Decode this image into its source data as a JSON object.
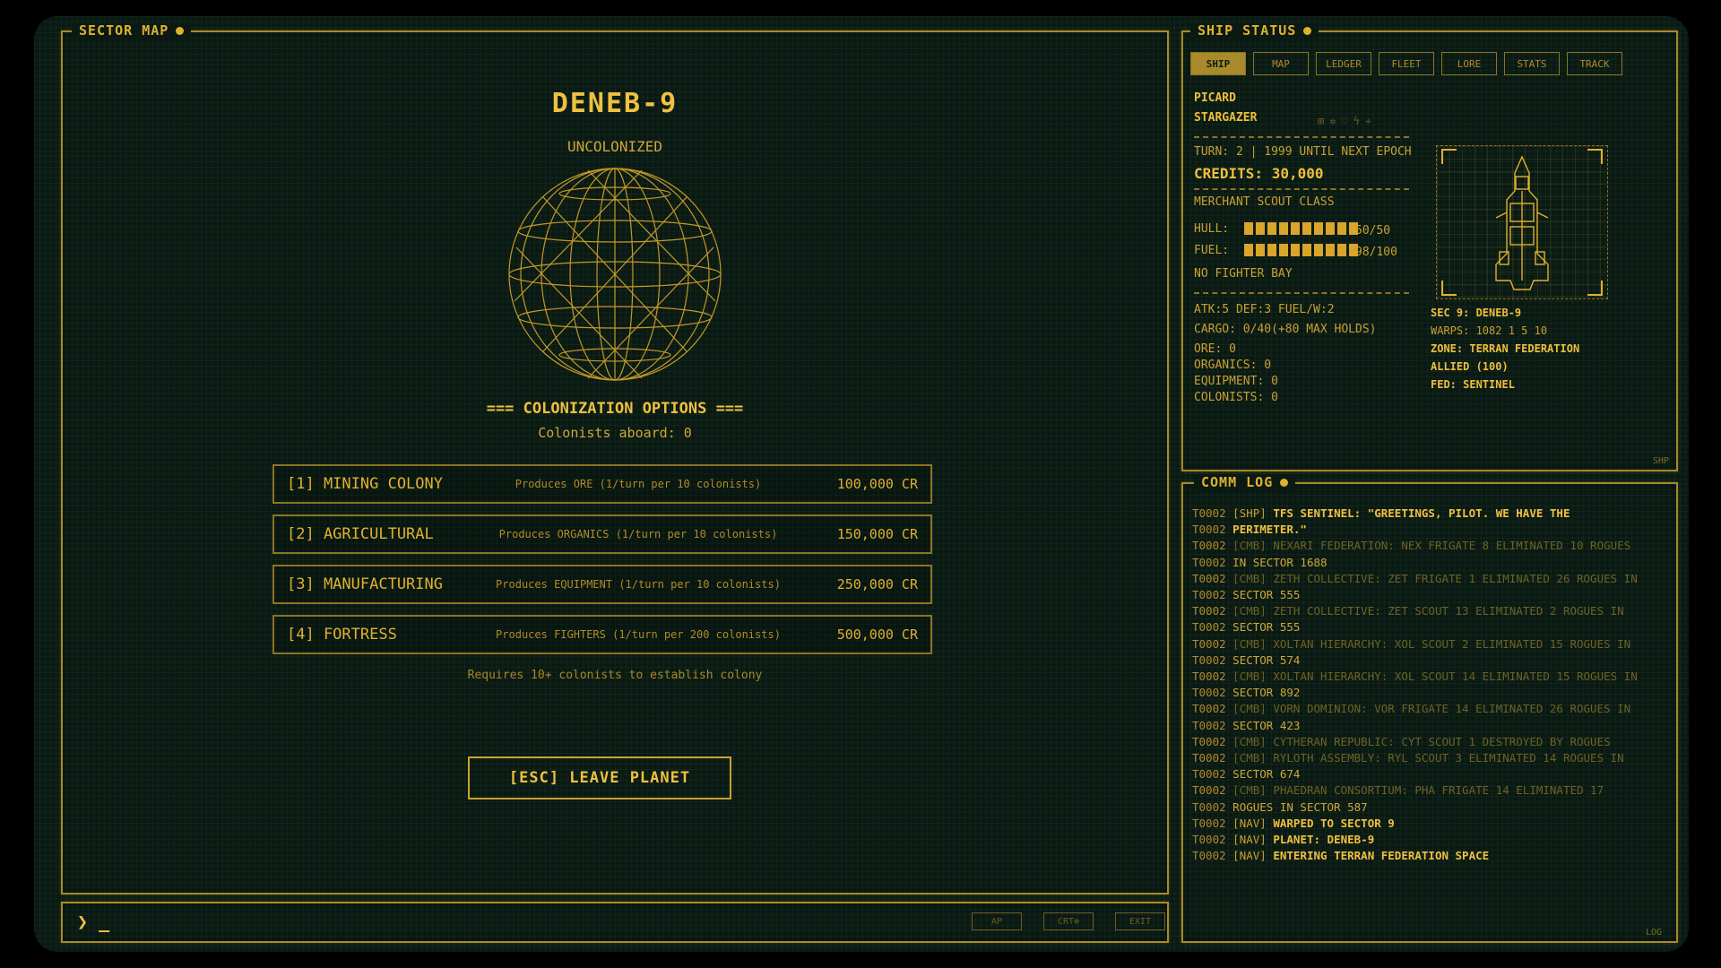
{
  "sector": {
    "title": "SECTOR MAP",
    "planet_name": "DENEB-9",
    "planet_status": "UNCOLONIZED",
    "colonization_title": "=== COLONIZATION OPTIONS ===",
    "colonists": "Colonists aboard: 0",
    "options": [
      {
        "name": "[1] MINING COLONY",
        "desc": "Produces ORE (1/turn per 10 colonists)",
        "price": "100,000 CR"
      },
      {
        "name": "[2] AGRICULTURAL",
        "desc": "Produces ORGANICS (1/turn per 10 colonists)",
        "price": "150,000 CR"
      },
      {
        "name": "[3] MANUFACTURING",
        "desc": "Produces EQUIPMENT (1/turn per 10 colonists)",
        "price": "250,000 CR"
      },
      {
        "name": "[4] FORTRESS",
        "desc": "Produces FIGHTERS (1/turn per 200 colonists)",
        "price": "500,000 CR"
      }
    ],
    "requirement": "Requires 10+ colonists to establish colony",
    "leave_button": "[ESC] LEAVE PLANET"
  },
  "command": {
    "prompt": "❯ _",
    "buttons": [
      "AP",
      "CRT⊕",
      "EXIT"
    ]
  },
  "ship": {
    "title": "SHIP STATUS",
    "tabs": [
      "SHIP",
      "MAP",
      "LEDGER",
      "FLEET",
      "LORE",
      "STATS",
      "TRACK"
    ],
    "active_tab": "SHIP",
    "pilot": "PICARD",
    "ship_name": "STARGAZER",
    "icons": [
      "grid-icon",
      "sun-icon",
      "shield-icon",
      "bolt-icon",
      "target-icon"
    ],
    "turn": "TURN: 2 | 1999 UNTIL NEXT EPOCH",
    "credits": "CREDITS: 30,000",
    "ship_class": "MERCHANT SCOUT CLASS",
    "hull_label": "HULL:",
    "hull_value": "50/50",
    "hull_fraction": 1.0,
    "fuel_label": "FUEL:",
    "fuel_value": "98/100",
    "fuel_fraction": 0.98,
    "fighter_bay": "NO FIGHTER BAY",
    "combat": "ATK:5 DEF:3 FUEL/W:2",
    "cargo": "CARGO: 0/40(+80 MAX HOLDS)",
    "ore": "ORE: 0",
    "organics": "ORGANICS: 0",
    "equipment": "EQUIPMENT: 0",
    "colonists": "COLONISTS: 0",
    "sector": "SEC 9: DENEB-9",
    "warps": "WARPS: 1082 1 5 10",
    "zone": "ZONE: TERRAN FEDERATION",
    "allied": "ALLIED (100)",
    "fed": "FED: SENTINEL",
    "corner": "SHP"
  },
  "comm": {
    "title": "COMM LOG",
    "corner": "LOG",
    "lines": [
      {
        "t": "T0002",
        "tag": "[SHP]",
        "msg": "TFS SENTINEL: \"GREETINGS, PILOT. WE HAVE THE",
        "style": "hi"
      },
      {
        "t": "T0002",
        "tag": "",
        "msg": "PERIMETER.\"",
        "style": "hi"
      },
      {
        "t": "T0002",
        "tag": "[CMB]",
        "msg": "NEXARI FEDERATION: NEX FRIGATE 8 ELIMINATED 10 ROGUES",
        "style": "dim"
      },
      {
        "t": "T0002",
        "tag": "",
        "msg": "IN SECTOR 1688",
        "style": "cont"
      },
      {
        "t": "T0002",
        "tag": "[CMB]",
        "msg": "ZETH COLLECTIVE: ZET FRIGATE 1 ELIMINATED 26 ROGUES IN",
        "style": "dim"
      },
      {
        "t": "T0002",
        "tag": "",
        "msg": "SECTOR 555",
        "style": "cont"
      },
      {
        "t": "T0002",
        "tag": "[CMB]",
        "msg": "ZETH COLLECTIVE: ZET SCOUT 13 ELIMINATED 2 ROGUES IN",
        "style": "dim"
      },
      {
        "t": "T0002",
        "tag": "",
        "msg": "SECTOR 555",
        "style": "cont"
      },
      {
        "t": "T0002",
        "tag": "[CMB]",
        "msg": "XOLTAN HIERARCHY: XOL SCOUT 2 ELIMINATED 15 ROGUES IN",
        "style": "dim"
      },
      {
        "t": "T0002",
        "tag": "",
        "msg": "SECTOR 574",
        "style": "cont"
      },
      {
        "t": "T0002",
        "tag": "[CMB]",
        "msg": "XOLTAN HIERARCHY: XOL SCOUT 14 ELIMINATED 15 ROGUES IN",
        "style": "dim"
      },
      {
        "t": "T0002",
        "tag": "",
        "msg": "SECTOR 892",
        "style": "cont"
      },
      {
        "t": "T0002",
        "tag": "[CMB]",
        "msg": "VORN DOMINION: VOR FRIGATE 14 ELIMINATED 26 ROGUES IN",
        "style": "dim"
      },
      {
        "t": "T0002",
        "tag": "",
        "msg": "SECTOR 423",
        "style": "cont"
      },
      {
        "t": "T0002",
        "tag": "[CMB]",
        "msg": "CYTHERAN REPUBLIC: CYT SCOUT 1 DESTROYED BY ROGUES",
        "style": "dim"
      },
      {
        "t": "T0002",
        "tag": "[CMB]",
        "msg": "RYLOTH ASSEMBLY: RYL SCOUT 3 ELIMINATED 14 ROGUES IN",
        "style": "dim"
      },
      {
        "t": "T0002",
        "tag": "",
        "msg": "SECTOR 674",
        "style": "cont"
      },
      {
        "t": "T0002",
        "tag": "[CMB]",
        "msg": "PHAEDRAN CONSORTIUM: PHA FRIGATE 14 ELIMINATED 17",
        "style": "dim"
      },
      {
        "t": "T0002",
        "tag": "",
        "msg": "ROGUES IN SECTOR 587",
        "style": "cont"
      },
      {
        "t": "T0002",
        "tag": "[NAV]",
        "msg": "WARPED TO SECTOR 9",
        "style": "hi"
      },
      {
        "t": "T0002",
        "tag": "[NAV]",
        "msg": "PLANET: DENEB-9",
        "style": "hi"
      },
      {
        "t": "T0002",
        "tag": "[NAV]",
        "msg": "ENTERING TERRAN FEDERATION SPACE",
        "style": "hi"
      }
    ]
  },
  "colors": {
    "amber": "#d9a52a",
    "bright": "#f0c040",
    "bg": "#0a1a13"
  }
}
